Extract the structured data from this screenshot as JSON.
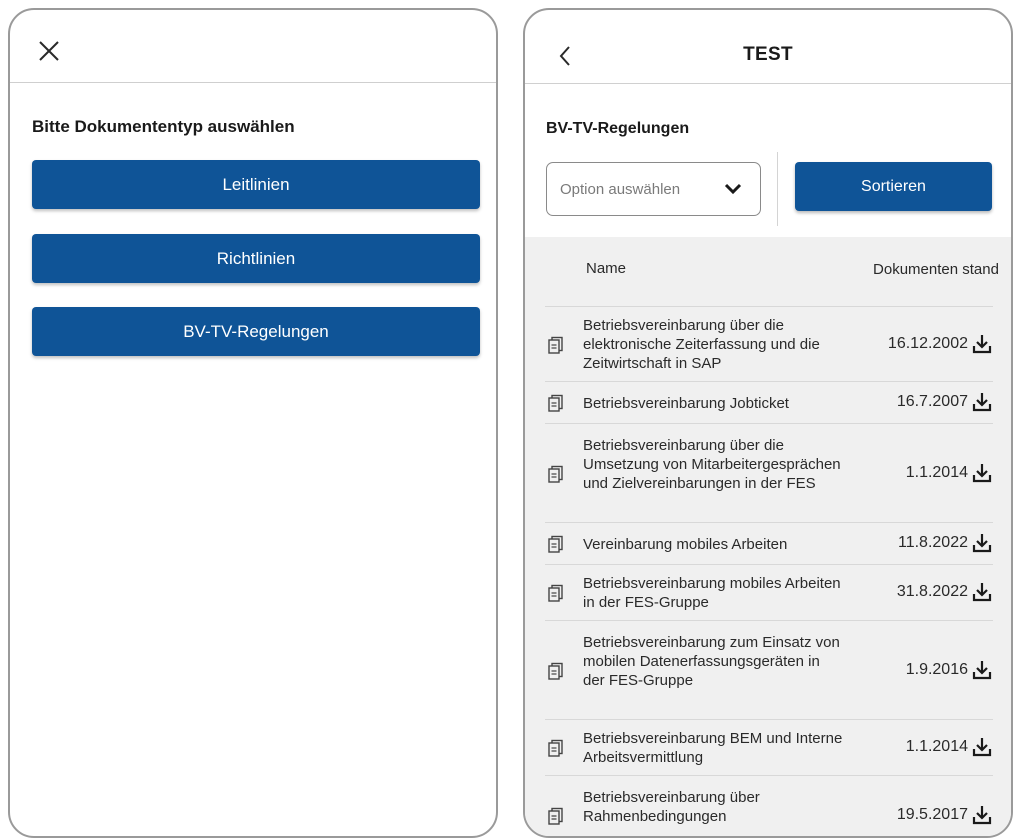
{
  "left": {
    "title": "Bitte Dokumententyp auswählen",
    "buttons": [
      "Leitlinien",
      "Richtlinien",
      "BV-TV-Regelungen"
    ]
  },
  "right": {
    "title": "TEST",
    "section_title": "BV-TV-Regelungen",
    "select_placeholder": "Option auswählen",
    "sort_label": "Sortieren",
    "col_name": "Name",
    "col_date": "Dokumenten stand",
    "rows": [
      {
        "name": "Betriebsvereinbarung über die elektronische Zeiterfassung und die Zeitwirtschaft in SAP",
        "date": "16.12.2002"
      },
      {
        "name": "Betriebsvereinbarung Jobticket",
        "date": "16.7.2007"
      },
      {
        "name": "Betriebsvereinbarung über die Umsetzung von Mitarbeitergesprächen und Zielvereinbarungen in der FES",
        "date": "1.1.2014"
      },
      {
        "name": "Vereinbarung mobiles Arbeiten",
        "date": "11.8.2022"
      },
      {
        "name": "Betriebsvereinbarung mobiles Arbeiten in der FES-Gruppe",
        "date": "31.8.2022"
      },
      {
        "name": "Betriebsvereinbarung zum Einsatz von mobilen Datenerfassungsgeräten in der FES-Gruppe",
        "date": "1.9.2016"
      },
      {
        "name": "Betriebsvereinbarung BEM und Interne Arbeitsvermittlung",
        "date": "1.1.2014"
      },
      {
        "name": "Betriebsvereinbarung über Rahmenbedingungen",
        "date": "19.5.2017"
      }
    ]
  },
  "colors": {
    "primary": "#0f5497",
    "list_bg": "#f0f0f0"
  }
}
